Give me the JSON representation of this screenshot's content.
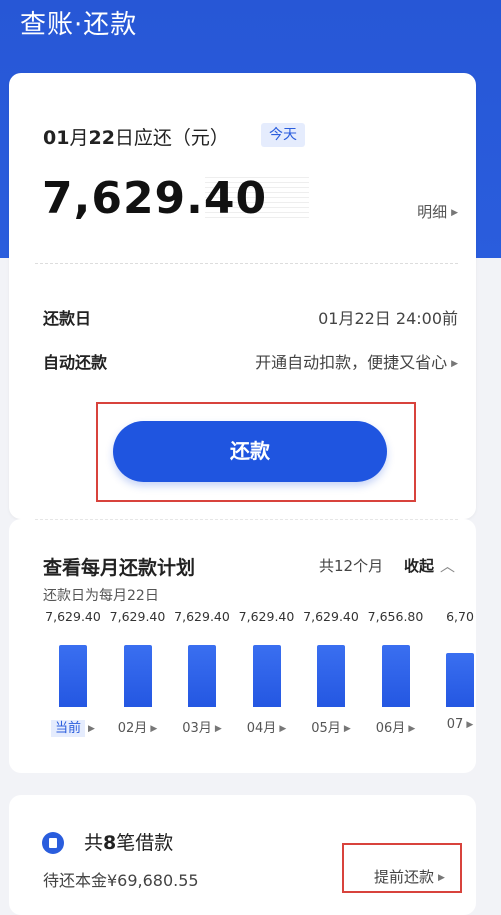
{
  "header": {
    "title": "查账·还款"
  },
  "due": {
    "date_month": "01",
    "month_unit": "月",
    "date_day": "22",
    "suffix": "日应还（元）",
    "today_badge": "今天",
    "amount": "7,629.40",
    "detail_link": "明细"
  },
  "info_rows": [
    {
      "label": "还款日",
      "value": "01月22日 24:00前"
    },
    {
      "label": "自动还款",
      "value": "开通自动扣款，便捷又省心"
    }
  ],
  "pay_button": "还款",
  "plan": {
    "title": "查看每月还款计划",
    "subtitle": "还款日为每月22日",
    "count": "共12个月",
    "collapse": "收起"
  },
  "chart_data": {
    "type": "bar",
    "categories": [
      "当前",
      "02月",
      "03月",
      "04月",
      "05月",
      "06月",
      "07"
    ],
    "values": [
      7629.4,
      7629.4,
      7629.4,
      7629.4,
      7629.4,
      7656.8,
      6700
    ],
    "value_labels": [
      "7,629.40",
      "7,629.40",
      "7,629.40",
      "7,629.40",
      "7,629.40",
      "7,656.80",
      "6,70"
    ]
  },
  "loans": {
    "prefix": "共",
    "count": "8",
    "suffix": "笔借款",
    "principal": "待还本金¥69,680.55",
    "prepay_link": "提前还款"
  },
  "colors": {
    "brand": "#2a5ddd",
    "button": "#1f55e0",
    "highlight_frame": "#d8433c"
  }
}
